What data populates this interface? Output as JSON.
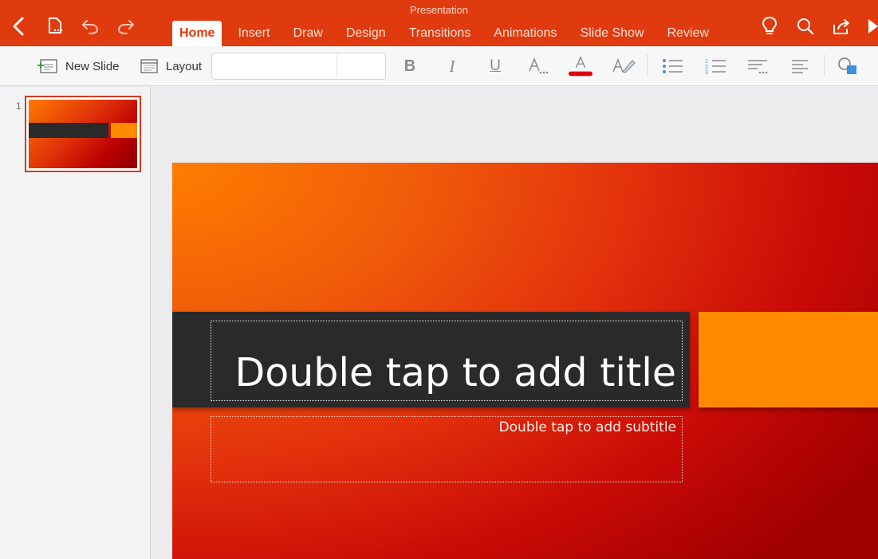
{
  "app": {
    "title": "Presentation"
  },
  "ribbon": {
    "tabs": [
      {
        "label": "Home",
        "active": true
      },
      {
        "label": "Insert"
      },
      {
        "label": "Draw"
      },
      {
        "label": "Design"
      },
      {
        "label": "Transitions"
      },
      {
        "label": "Animations"
      },
      {
        "label": "Slide Show"
      },
      {
        "label": "Review"
      }
    ]
  },
  "toolbar": {
    "new_slide_label": "New Slide",
    "layout_label": "Layout",
    "font_name": "",
    "font_size": "",
    "font_color": "#e3000b"
  },
  "thumbnails": [
    {
      "number": "1"
    }
  ],
  "slide": {
    "title_placeholder": "Double tap to add title",
    "subtitle_placeholder": "Double tap to add subtitle"
  },
  "colors": {
    "ribbon": "#e03a0f",
    "title_band": "#2a2a2a",
    "accent_orange": "#ff8a00",
    "selection": "#d43a1a"
  }
}
